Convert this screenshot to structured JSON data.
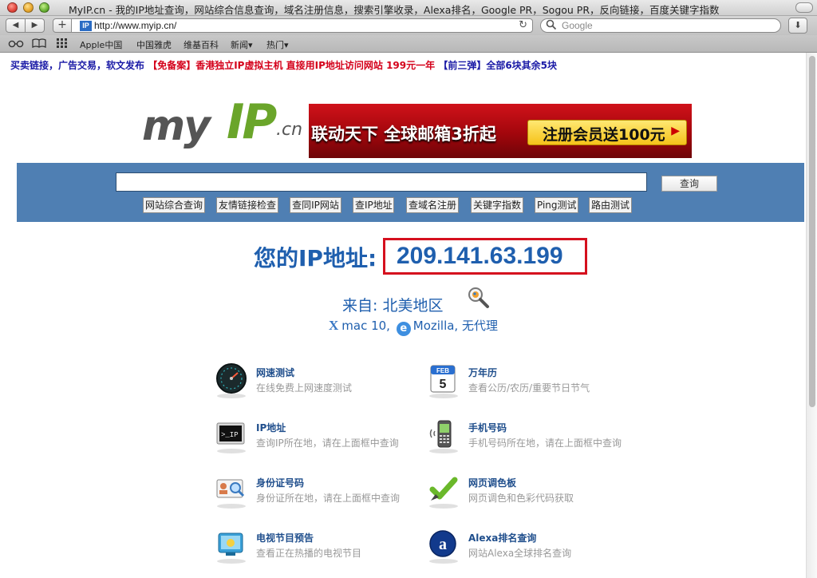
{
  "window": {
    "title": "MyIP.cn - 我的IP地址查询，网站综合信息查询，域名注册信息，搜索引擎收录，Alexa排名，Google PR，Sogou PR，反向链接，百度关键字指数"
  },
  "toolbar": {
    "url": "http://www.myip.cn/",
    "favicon_text": "IP",
    "search_placeholder": "Google"
  },
  "bookmarks": [
    "Apple中国",
    "中国雅虎",
    "维基百科",
    "新闻▾",
    "热门▾"
  ],
  "promo": {
    "part1": "买卖链接，广告交易，软文发布",
    "part2": "【免备案】香港独立IP虚拟主机 直接用IP地址访问网站 199元一年",
    "part3": "【前三弹】全部6块其余5块"
  },
  "logo": {
    "my": "my",
    "ip": "IP",
    "cn": ".cn"
  },
  "banner": {
    "left_text": "联动天下 全球邮箱3折起",
    "button_text": "注册会员送100元"
  },
  "search": {
    "input_value": "",
    "button_label": "查询",
    "links": [
      "网站综合查询",
      "友情链接检查",
      "查同IP网站",
      "查IP地址",
      "查域名注册",
      "关键字指数",
      "Ping测试",
      "路由测试"
    ]
  },
  "ip": {
    "label": "您的IP地址:",
    "value": "209.141.63.199"
  },
  "location": {
    "from_label": "来自: 北美地区",
    "os": "mac 10,",
    "browser": "Mozilla,",
    "proxy": "无代理"
  },
  "services": [
    {
      "title": "网速测试",
      "desc": "在线免费上网速度测试",
      "icon": "speedometer-icon"
    },
    {
      "title": "万年历",
      "desc": "查看公历/农历/重要节日节气",
      "icon": "calendar-icon",
      "cal_month": "FEB",
      "cal_day": "5"
    },
    {
      "title": "IP地址",
      "desc": "查询IP所在地，请在上面框中查询",
      "icon": "terminal-icon",
      "terminal_text": ">_IP"
    },
    {
      "title": "手机号码",
      "desc": "手机号码所在地，请在上面框中查询",
      "icon": "mobile-phone-icon"
    },
    {
      "title": "身份证号码",
      "desc": "身份证所在地，请在上面框中查询",
      "icon": "id-card-icon"
    },
    {
      "title": "网页调色板",
      "desc": "网页调色和色彩代码获取",
      "icon": "color-palette-icon"
    },
    {
      "title": "电视节目预告",
      "desc": "查看正在热播的电视节目",
      "icon": "tv-icon"
    },
    {
      "title": "Alexa排名查询",
      "desc": "网站Alexa全球排名查询",
      "icon": "alexa-icon"
    }
  ],
  "colors": {
    "search_bar": "#4f7fb3",
    "ip_blue": "#1f5fae",
    "ip_border": "#d5101e",
    "promo_blue": "#1a1aa6",
    "promo_red": "#d4001a"
  }
}
